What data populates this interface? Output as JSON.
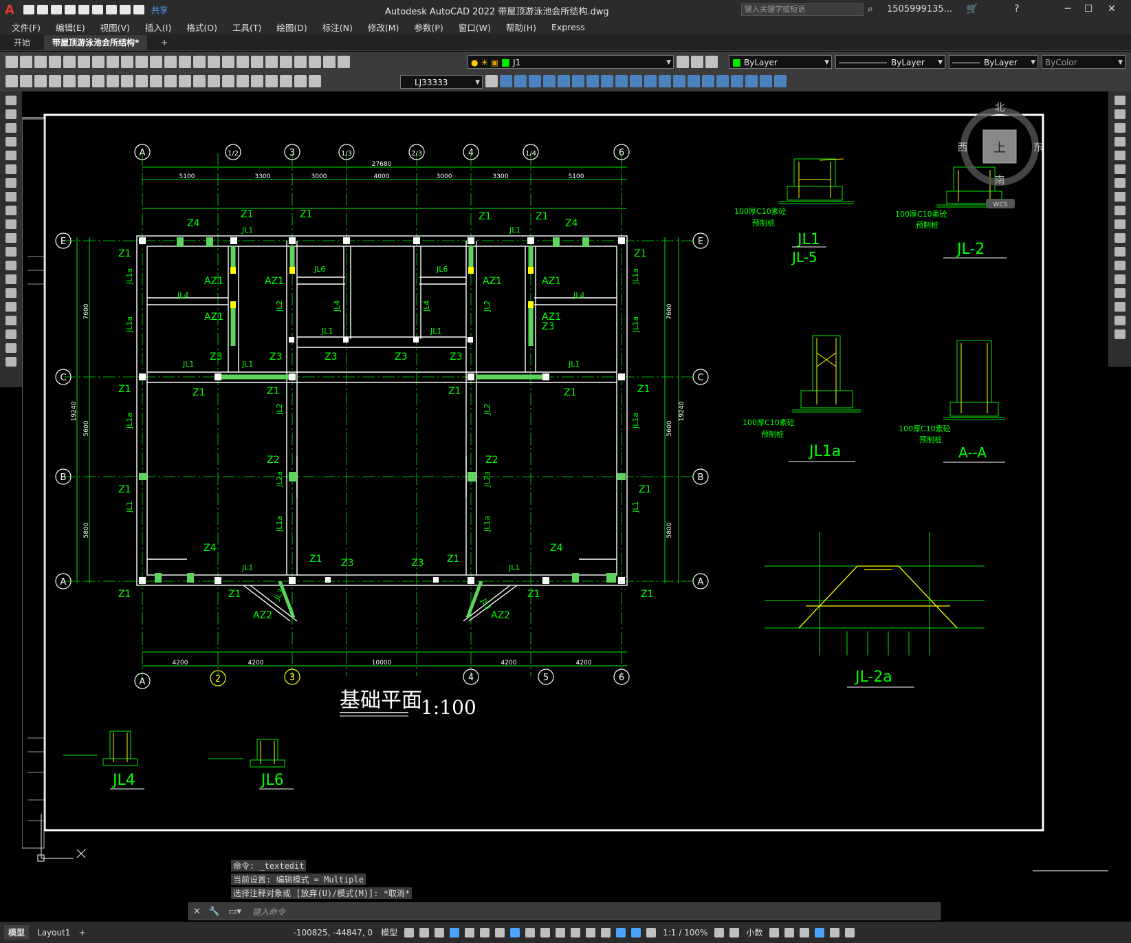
{
  "app": {
    "window_title": "Autodesk AutoCAD 2022    带屋顶游泳池会所结构.dwg",
    "share_label": "共享",
    "search_placeholder": "键入关键字或短语",
    "user": "1505999135...",
    "logo": "A"
  },
  "menu": [
    "文件(F)",
    "编辑(E)",
    "视图(V)",
    "插入(I)",
    "格式(O)",
    "工具(T)",
    "绘图(D)",
    "标注(N)",
    "修改(M)",
    "参数(P)",
    "窗口(W)",
    "帮助(H)",
    "Express"
  ],
  "tabs": [
    {
      "label": "开始",
      "active": false
    },
    {
      "label": "带屋顶游泳池会所结构*",
      "active": true
    },
    {
      "label": "+",
      "active": false
    }
  ],
  "toolbar": {
    "layer": "J1",
    "color": "ByLayer",
    "linetype": "ByLayer",
    "lineweight": "ByLayer",
    "plotstyle": "ByColor",
    "style_combo": "LJ33333"
  },
  "viewcube": {
    "north": "北",
    "south": "南",
    "east": "东",
    "west": "西",
    "face": "上",
    "wcs": "WCS"
  },
  "drawing": {
    "main_title": "基础平面",
    "main_scale": "1:100",
    "total_dim": "27680",
    "top_dims": [
      "5100",
      "3300",
      "3000",
      "4000",
      "3000",
      "3300",
      "5100"
    ],
    "grid_top": [
      "A",
      "1/2",
      "3",
      "1/3",
      "2/3",
      "4",
      "1/4",
      "6"
    ],
    "grid_bottom": [
      "A",
      "2",
      "3",
      "4",
      "5",
      "6"
    ],
    "grid_side": [
      "E",
      "C",
      "B",
      "A"
    ],
    "bottom_dims": [
      "4200",
      "4200",
      "10000",
      "4200",
      "4200"
    ],
    "side_dims": [
      "7600",
      "5600",
      "5800",
      "19240"
    ],
    "labels": [
      "Z1",
      "Z3",
      "Z4",
      "AZ1",
      "AZ2",
      "Z2",
      "JL1",
      "JL2",
      "JL4",
      "JL6",
      "JL1a",
      "JL2a",
      "JL3"
    ],
    "details": [
      "JL1",
      "JL-5",
      "JL-2",
      "JL1a",
      "A--A",
      "JL-2a",
      "JL4",
      "JL6"
    ],
    "notes": {
      "c10": "100厚C10素砼",
      "pile": "预制桩"
    }
  },
  "command": {
    "lines": [
      "命令: _textedit",
      "当前设置: 编辑模式 = Multiple",
      "选择注释对象或 [放弃(U)/模式(M)]: *取消*"
    ],
    "placeholder": "键入命令"
  },
  "status": {
    "model_tab": "模型",
    "layout_tab": "Layout1",
    "add_tab": "+",
    "coords": "-100825, -44847, 0",
    "space": "模型",
    "scale": "1:1 / 100%",
    "units": "小数"
  }
}
